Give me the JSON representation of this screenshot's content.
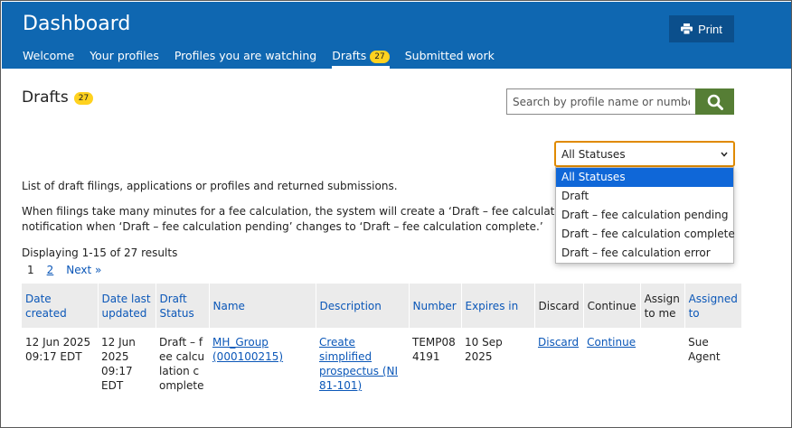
{
  "header": {
    "title": "Dashboard",
    "print_label": "Print",
    "nav": [
      {
        "label": "Welcome"
      },
      {
        "label": "Your profiles"
      },
      {
        "label": "Profiles you are watching"
      },
      {
        "label": "Drafts",
        "badge": "27"
      },
      {
        "label": "Submitted work"
      }
    ]
  },
  "main": {
    "title": "Drafts",
    "badge": "27",
    "search_placeholder": "Search by profile name or number",
    "status_filter": {
      "selected": "All Statuses",
      "options": [
        "All Statuses",
        "Draft",
        "Draft – fee calculation pending",
        "Draft – fee calculation complete",
        "Draft – fee calculation error"
      ]
    },
    "description": "List of draft filings, applications or profiles and returned submissions.",
    "notice_line1": "When filings take many minutes for a fee calculation, the system will create a ‘Draft – fee calculation pendi",
    "notice_line2": "notification when ‘Draft – fee calculation pending’ changes to ‘Draft – fee calculation complete.’",
    "displaying": "Displaying 1-15 of 27 results",
    "pagination": {
      "current": "1",
      "page2": "2",
      "next": "Next »"
    }
  },
  "table": {
    "headers": {
      "date_created": "Date created",
      "date_updated": "Date last updated",
      "draft_status": "Draft Status",
      "name": "Name",
      "description": "Description",
      "number": "Number",
      "expires": "Expires in",
      "discard": "Discard",
      "continue": "Continue",
      "assign": "Assign to me",
      "assigned": "Assigned to"
    },
    "rows": [
      {
        "date_created": "12 Jun 2025 09:17 EDT",
        "date_updated": "12 Jun 2025 09:17 EDT",
        "draft_status": "Draft – fee calculation complete",
        "name": "MH_Group (000100215)",
        "description": "Create simplified prospectus (NI 81-101)",
        "number": "TEMP084191",
        "expires": "10 Sep 2025",
        "discard": "Discard",
        "continue": "Continue",
        "assign": "",
        "assigned": "Sue Agent"
      }
    ]
  },
  "colors": {
    "header_bg": "#0f67b1",
    "print_bg": "#0b4f8c",
    "badge": "#ffd21f",
    "search_btn": "#567e35",
    "select_border": "#e08a00",
    "selected_option": "#0f67d8",
    "link": "#0b57b8"
  }
}
